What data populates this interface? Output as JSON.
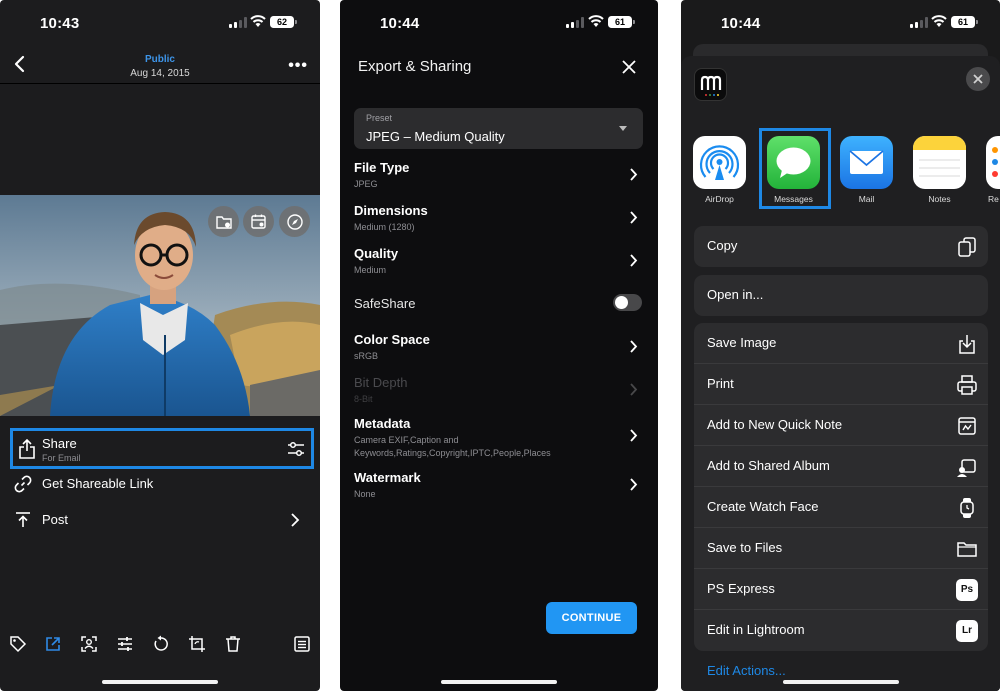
{
  "screen1": {
    "status": {
      "time": "10:43",
      "battery": "62"
    },
    "nav": {
      "title": "Public",
      "subtitle": "Aug 14, 2015",
      "back_icon": "chevron-left-icon",
      "more_icon": "ellipsis-icon"
    },
    "photo_buttons": [
      "add-to-folder-icon",
      "calendar-icon",
      "compass-icon"
    ],
    "share": {
      "label": "Share",
      "sublabel": "For Email"
    },
    "rows": [
      {
        "label": "Get Shareable Link",
        "icon": "link-icon"
      },
      {
        "label": "Post",
        "icon": "post-upload-icon"
      }
    ],
    "toolbar": [
      "tag-icon",
      "export-icon",
      "person-tag-icon",
      "adjust-sliders-icon",
      "rotate-icon",
      "crop-icon",
      "trash-icon",
      "info-list-icon"
    ]
  },
  "screen2": {
    "status": {
      "time": "10:44",
      "battery": "61"
    },
    "title": "Export & Sharing",
    "preset": {
      "label": "Preset",
      "value": "JPEG – Medium Quality"
    },
    "options": [
      {
        "name": "File Type",
        "detail": "JPEG"
      },
      {
        "name": "Dimensions",
        "detail": "Medium (1280)"
      },
      {
        "name": "Quality",
        "detail": "Medium"
      },
      {
        "name": "SafeShare",
        "detail": ""
      },
      {
        "name": "Color Space",
        "detail": "sRGB"
      },
      {
        "name": "Bit Depth",
        "detail": "8-Bit"
      },
      {
        "name": "Metadata",
        "detail": "Camera EXIF,Caption and Keywords,Ratings,Copyright,IPTC,People,Places"
      },
      {
        "name": "Watermark",
        "detail": "None"
      }
    ],
    "safeshare_on": false,
    "continue_label": "CONTINUE"
  },
  "screen3": {
    "status": {
      "time": "10:44",
      "battery": "61"
    },
    "apps": [
      "AirDrop",
      "Messages",
      "Mail",
      "Notes",
      "Re"
    ],
    "group1": [
      {
        "label": "Copy",
        "icon": "copy-icon"
      }
    ],
    "group2": [
      {
        "label": "Open in...",
        "icon": ""
      }
    ],
    "group3": [
      {
        "label": "Save Image",
        "icon": "save-image-icon"
      },
      {
        "label": "Print",
        "icon": "printer-icon"
      },
      {
        "label": "Add to New Quick Note",
        "icon": "quick-note-icon"
      },
      {
        "label": "Add to Shared Album",
        "icon": "shared-album-icon"
      },
      {
        "label": "Create Watch Face",
        "icon": "watch-icon"
      },
      {
        "label": "Save to Files",
        "icon": "folder-icon"
      },
      {
        "label": "PS Express",
        "icon": "ps-express-icon"
      },
      {
        "label": "Edit in Lightroom",
        "icon": "lightroom-icon"
      }
    ],
    "ps_badge": "Ps",
    "lr_badge": "Lr",
    "edit_actions": "Edit Actions..."
  },
  "colors": {
    "accent_blue": "#1e88e5",
    "link_blue": "#3d94e8",
    "messages_green": "#34c759"
  }
}
